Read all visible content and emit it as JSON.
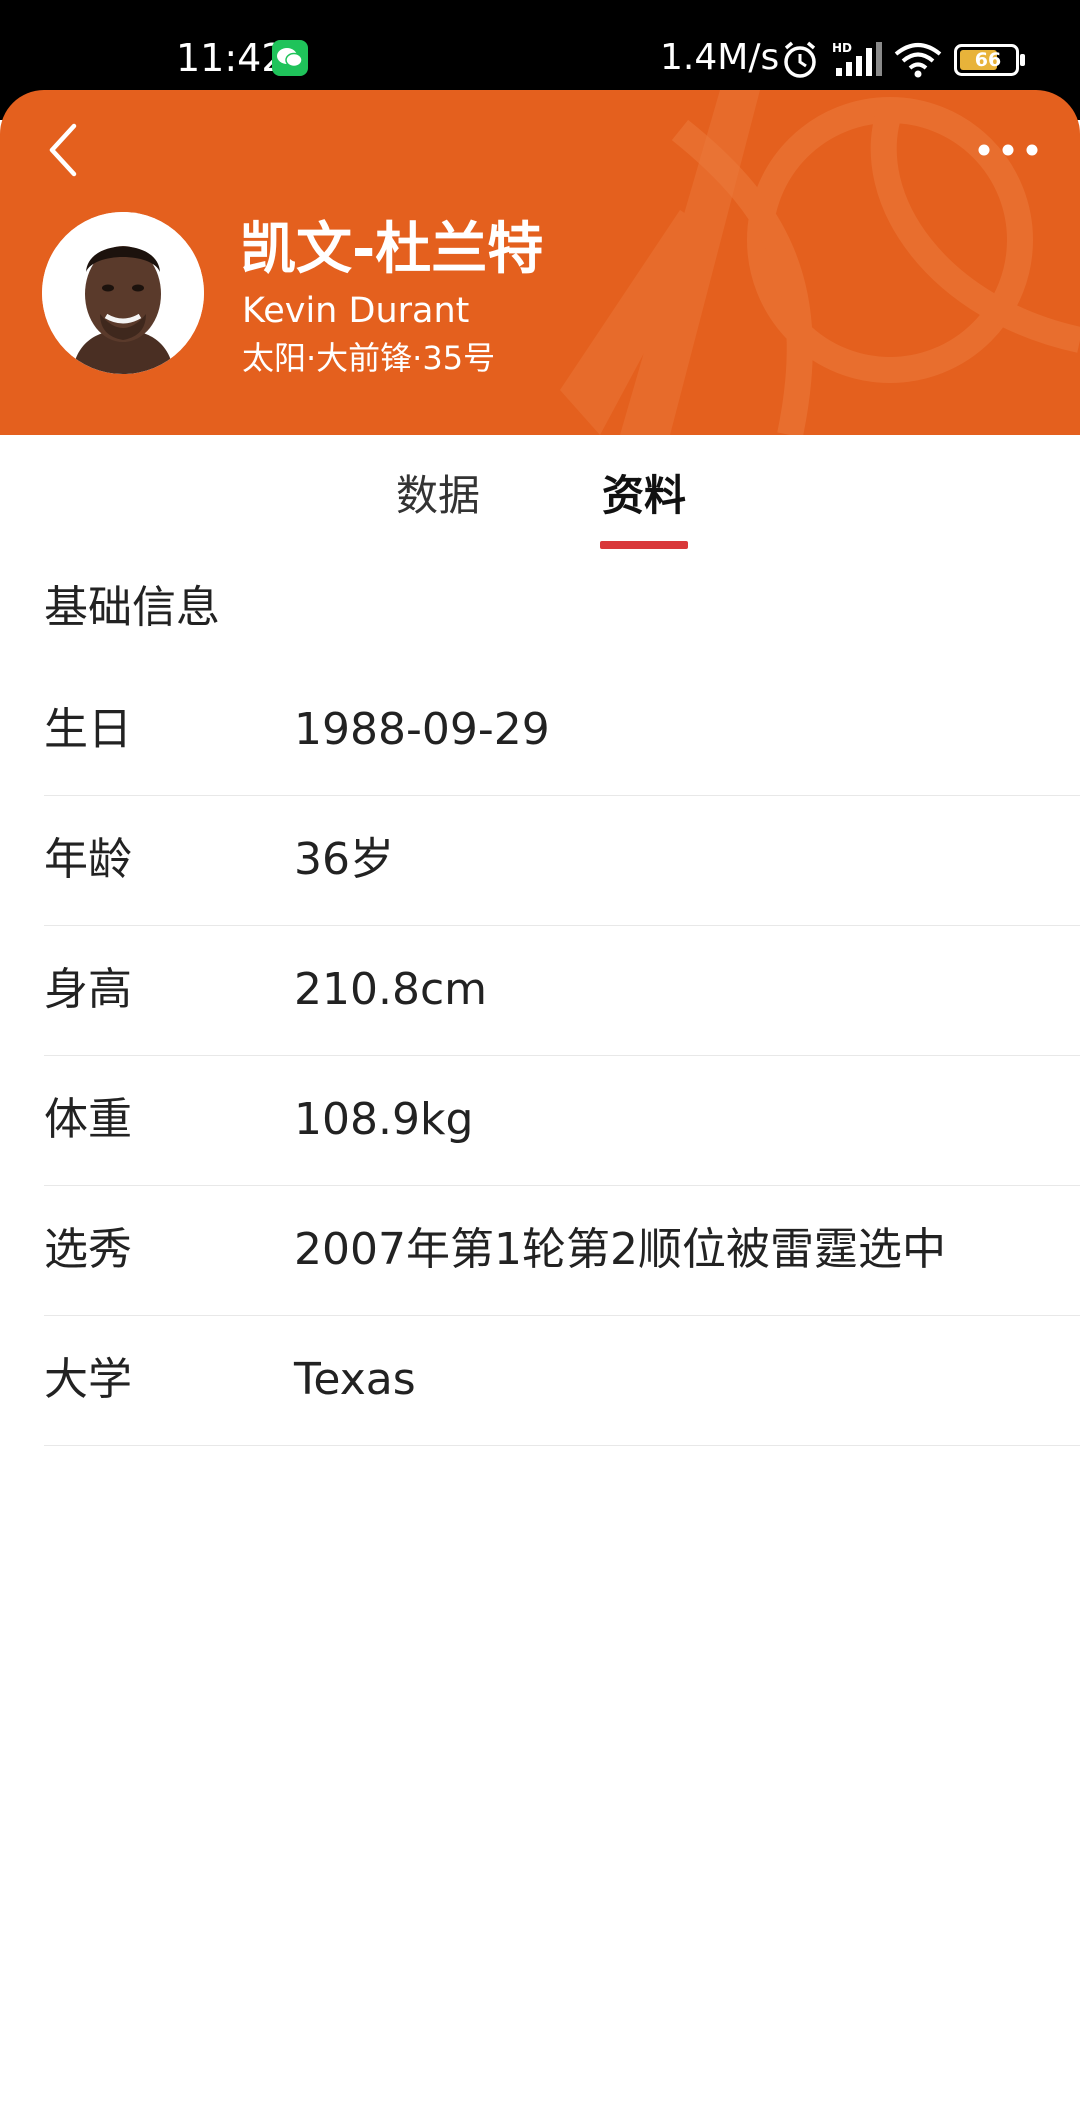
{
  "status_bar": {
    "time": "11:42",
    "net_speed": "1.4M/s",
    "battery_level": "66",
    "icons": [
      "wechat-icon",
      "alarm-icon",
      "hd-signal-icon",
      "wifi-icon",
      "battery-icon"
    ]
  },
  "header": {
    "name_cn": "凯文-杜兰特",
    "name_en": "Kevin Durant",
    "meta": "太阳·大前锋·35号",
    "accent_color": "#e4601e"
  },
  "tabs": [
    {
      "label": "数据",
      "selected": false
    },
    {
      "label": "资料",
      "selected": true
    }
  ],
  "tab_indicator_color": "#d9383a",
  "basic_info": {
    "title": "基础信息",
    "rows": [
      {
        "label": "生日",
        "value": "1988-09-29"
      },
      {
        "label": "年龄",
        "value": "36岁"
      },
      {
        "label": "身高",
        "value": "210.8cm"
      },
      {
        "label": "体重",
        "value": "108.9kg"
      },
      {
        "label": "选秀",
        "value": "2007年第1轮第2顺位被雷霆选中"
      },
      {
        "label": "大学",
        "value": "Texas"
      }
    ]
  }
}
